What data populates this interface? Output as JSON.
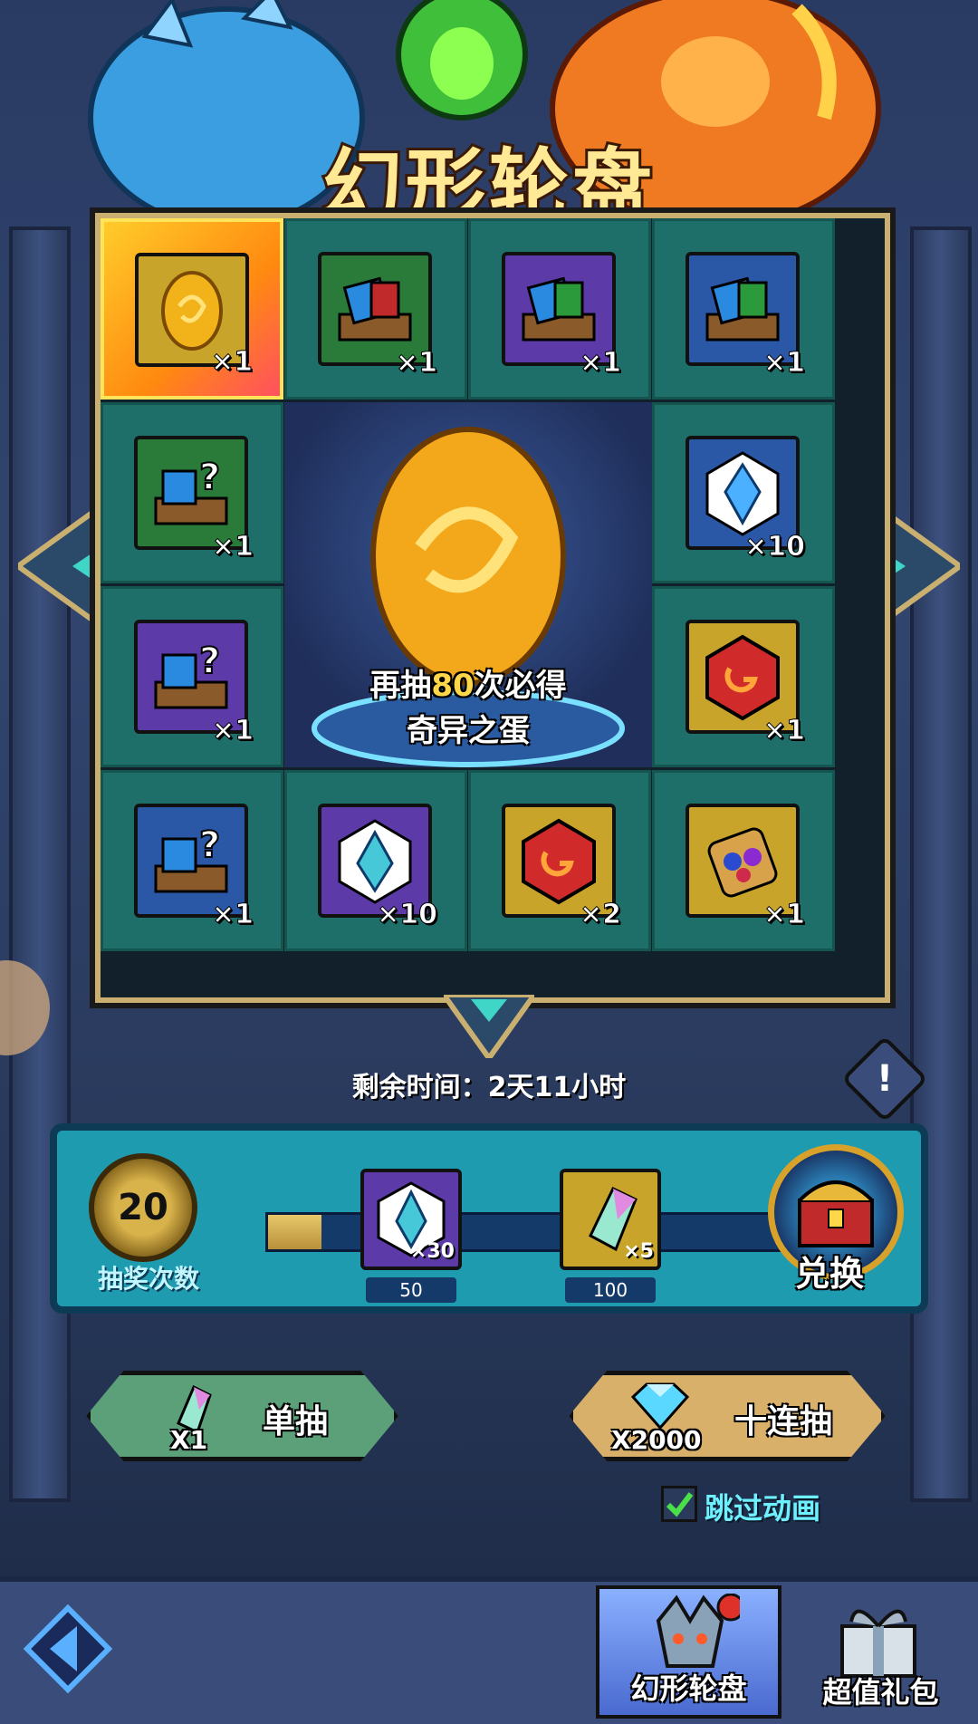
{
  "title": "幻形轮盘",
  "board": {
    "cells": [
      {
        "icon": "golden-egg-icon",
        "qty": "×1",
        "frame": "#c8a52a",
        "selected": true
      },
      {
        "icon": "card-chest-icon",
        "qty": "×1",
        "frame": "#2a7a3a"
      },
      {
        "icon": "card-chest-icon",
        "qty": "×1",
        "frame": "#5c3aa8"
      },
      {
        "icon": "card-chest-icon",
        "qty": "×1",
        "frame": "#2a57a6"
      },
      {
        "icon": "mystery-chest-icon",
        "qty": "×1",
        "frame": "#2a7a3a"
      },
      {
        "icon": "blue-crystal-icon",
        "qty": "×10",
        "frame": "#2a57a6"
      },
      {
        "icon": "mystery-chest-icon",
        "qty": "×1",
        "frame": "#5c3aa8"
      },
      {
        "icon": "red-rune-icon",
        "qty": "×1",
        "frame": "#c8a52a"
      },
      {
        "icon": "mystery-chest-icon",
        "qty": "×1",
        "frame": "#2a57a6"
      },
      {
        "icon": "purple-crystal-icon",
        "qty": "×10",
        "frame": "#5c3aa8"
      },
      {
        "icon": "red-rune-icon",
        "qty": "×2",
        "frame": "#c8a52a"
      },
      {
        "icon": "gem-amulet-icon",
        "qty": "×1",
        "frame": "#c8a52a"
      }
    ],
    "center_line1_prefix": "再抽",
    "center_line1_count": "80",
    "center_line1_suffix": "次必得",
    "center_line2": "奇异之蛋"
  },
  "timer": "剩余时间：2天11小时",
  "progress": {
    "count": "20",
    "label": "抽奖次数",
    "fill_fraction": 0.1,
    "milestones": [
      {
        "icon": "purple-crystal-icon",
        "qty": "×30",
        "threshold": "50"
      },
      {
        "icon": "prism-shard-icon",
        "qty": "×5",
        "threshold": "100"
      }
    ],
    "exchange_label": "兑换"
  },
  "single_draw": {
    "label": "单抽",
    "cost": "X1",
    "icon": "prism-shard-icon"
  },
  "ten_draw": {
    "label": "十连抽",
    "cost": "X2000",
    "icon": "diamond-icon"
  },
  "skip_animation": {
    "label": "跳过动画",
    "checked": true
  },
  "tabs": [
    {
      "label": "幻形轮盘",
      "icon": "dragon-head-icon",
      "active": true
    },
    {
      "label": "超值礼包",
      "icon": "gift-box-icon",
      "active": false
    }
  ],
  "colors": {
    "accent_gold": "#ffe995",
    "panel_teal": "#1f9bb0",
    "cell_teal": "#1e6f6a"
  }
}
